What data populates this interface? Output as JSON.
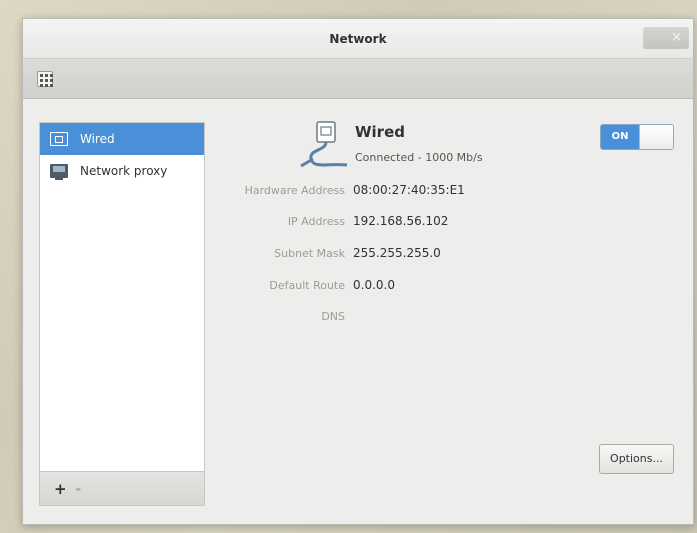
{
  "window": {
    "title": "Network",
    "close_glyph": "×"
  },
  "toolbar": {
    "menu_icon": "grid-icon"
  },
  "sidebar": {
    "items": [
      {
        "label": "Wired",
        "icon": "wired-icon",
        "selected": true
      },
      {
        "label": "Network proxy",
        "icon": "network-proxy-icon",
        "selected": false
      }
    ],
    "add_label": "+",
    "remove_label": "-"
  },
  "details": {
    "title": "Wired",
    "status": "Connected - 1000 Mb/s",
    "fields": [
      {
        "label": "Hardware Address",
        "value": "08:00:27:40:35:E1"
      },
      {
        "label": "IP Address",
        "value": "192.168.56.102"
      },
      {
        "label": "Subnet Mask",
        "value": "255.255.255.0"
      },
      {
        "label": "Default Route",
        "value": "0.0.0.0"
      },
      {
        "label": "DNS",
        "value": ""
      }
    ],
    "switch_label": "ON",
    "switch_on": true,
    "options_label": "Options..."
  },
  "colors": {
    "accent": "#4a90d9",
    "window_bg": "#ededeb"
  }
}
